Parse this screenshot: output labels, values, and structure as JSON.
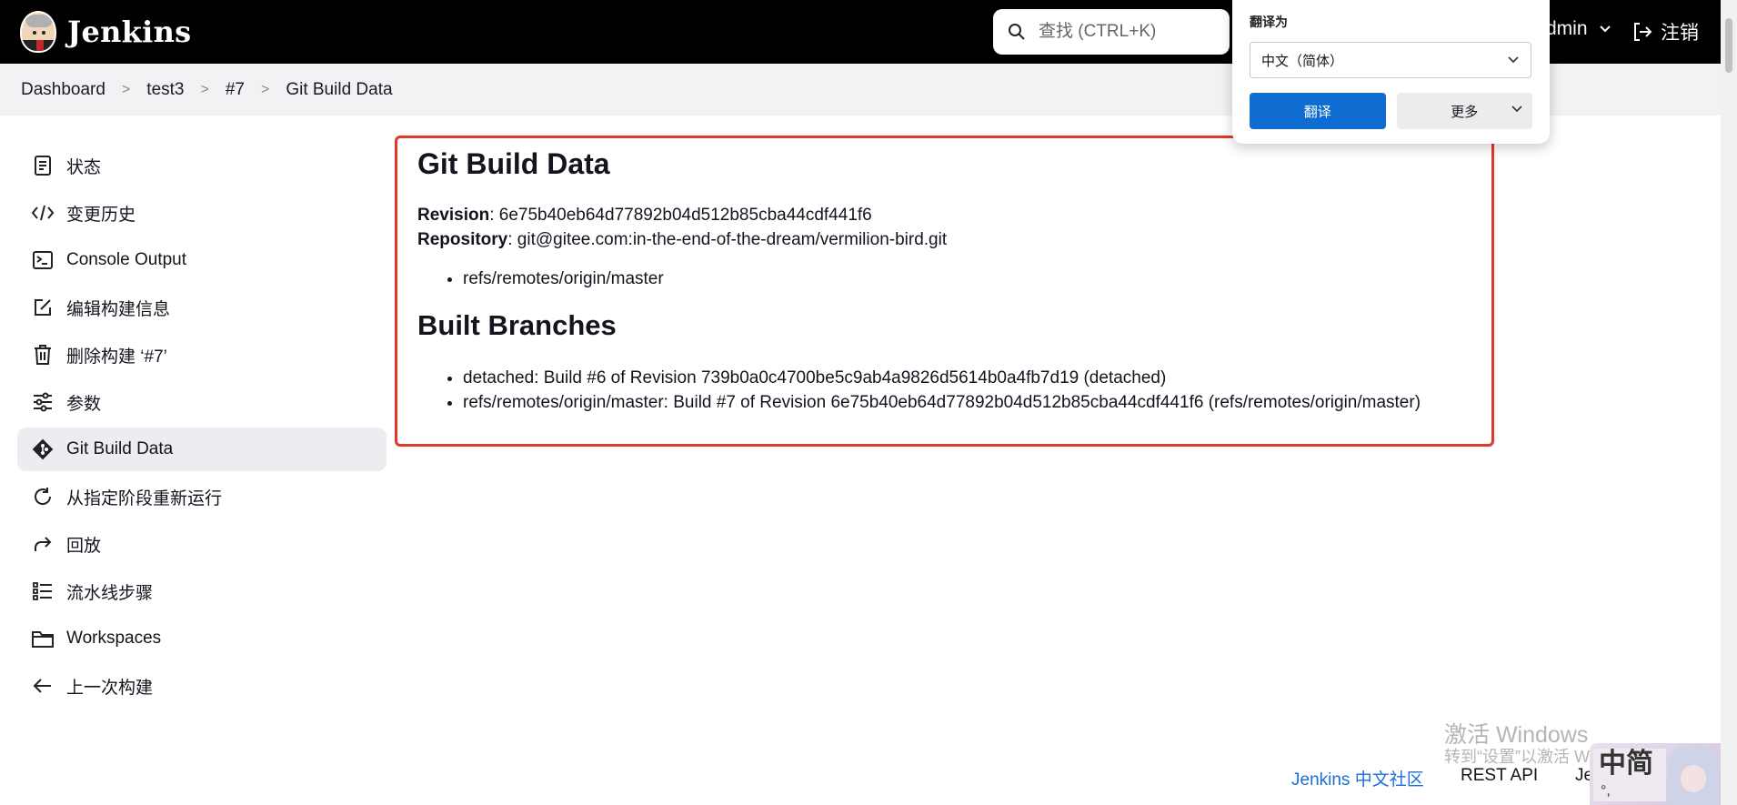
{
  "header": {
    "logo_text": "Jenkins",
    "search_placeholder": "查找 (CTRL+K)",
    "user_label": "dmin",
    "logout_label": "注销"
  },
  "breadcrumb": [
    "Dashboard",
    "test3",
    "#7",
    "Git Build Data"
  ],
  "sidebar": {
    "items": [
      {
        "label": "状态",
        "icon": "document-icon"
      },
      {
        "label": "变更历史",
        "icon": "code-icon"
      },
      {
        "label": "Console Output",
        "icon": "terminal-icon"
      },
      {
        "label": "编辑构建信息",
        "icon": "edit-icon"
      },
      {
        "label": "删除构建 ‘#7’",
        "icon": "trash-icon"
      },
      {
        "label": "参数",
        "icon": "sliders-icon"
      },
      {
        "label": "Git Build Data",
        "icon": "git-icon"
      },
      {
        "label": "从指定阶段重新运行",
        "icon": "restart-icon"
      },
      {
        "label": "回放",
        "icon": "replay-icon"
      },
      {
        "label": "流水线步骤",
        "icon": "list-icon"
      },
      {
        "label": "Workspaces",
        "icon": "folder-icon"
      },
      {
        "label": "上一次构建",
        "icon": "arrow-left-icon"
      }
    ],
    "active_index": 6
  },
  "main": {
    "title": "Git Build Data",
    "revision_label": "Revision",
    "revision_value": ": 6e75b40eb64d77892b04d512b85cba44cdf441f6",
    "repository_label": "Repository",
    "repository_value": ": git@gitee.com:in-the-end-of-the-dream/vermilion-bird.git",
    "refs": [
      "refs/remotes/origin/master"
    ],
    "built_branches_title": "Built Branches",
    "built_branches": [
      "detached: Build #6 of Revision 739b0a0c4700be5c9ab4a9826d5614b0a4fb7d19 (detached)",
      "refs/remotes/origin/master: Build #7 of Revision 6e75b40eb64d77892b04d512b85cba44cdf441f6 (refs/remotes/origin/master)"
    ]
  },
  "translate_popup": {
    "title": "翻译为",
    "language": "中文（简体）",
    "translate_button": "翻译",
    "more_button": "更多"
  },
  "footer": {
    "community_link": "Jenkins 中文社区",
    "rest_api_link": "REST API",
    "version_link": "Je"
  },
  "watermark": {
    "line1": "激活 Windows",
    "line2": "转到“设置”以激活 Windows。"
  },
  "ime": {
    "label": "中简",
    "dots": "°,"
  },
  "colors": {
    "header_bg": "#000000",
    "highlight_border": "#e03a2a",
    "link": "#1b6fd6",
    "translate_primary": "#0f6cd0"
  }
}
